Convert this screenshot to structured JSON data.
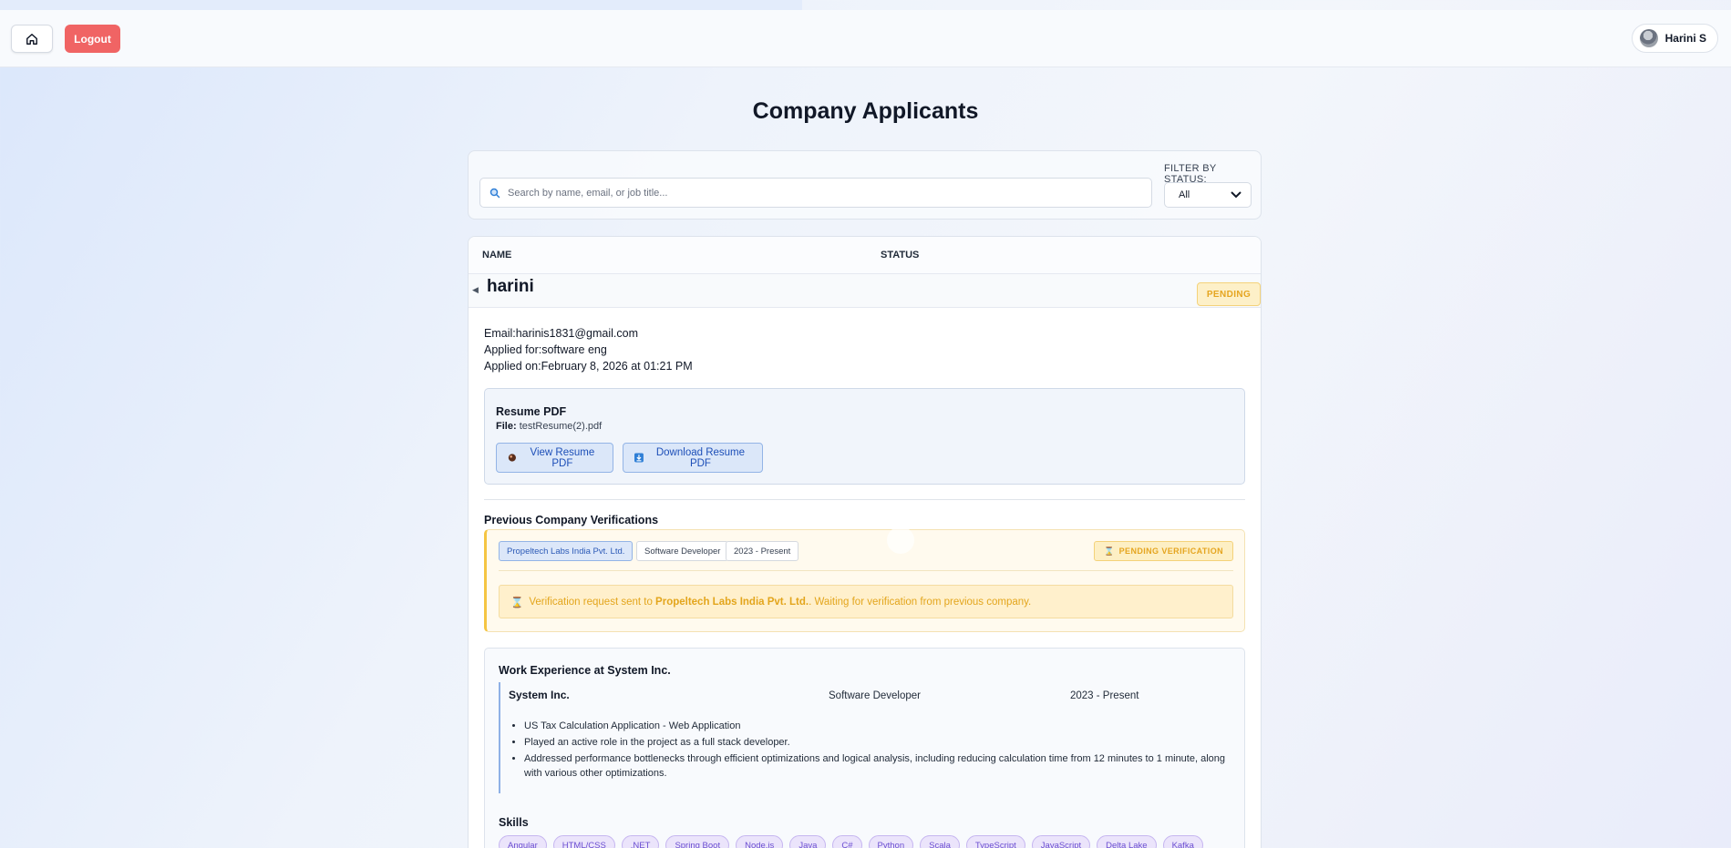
{
  "header": {
    "logout_label": "Logout",
    "user_name": "Harini S"
  },
  "page": {
    "title": "Company Applicants"
  },
  "filters": {
    "search_placeholder": "Search by name, email, or job title...",
    "status_label": "FILTER BY STATUS:",
    "status_value": "All"
  },
  "table": {
    "col_name": "NAME",
    "col_status": "STATUS"
  },
  "applicant": {
    "name": "harini",
    "status": "PENDING",
    "email_label": "Email:",
    "email": "harinis1831@gmail.com",
    "applied_for_label": "Applied for:",
    "applied_for": "software eng",
    "applied_on_label": "Applied on:",
    "applied_on": "February 8, 2026 at 01:21 PM",
    "resume": {
      "title": "Resume PDF",
      "file_label": "File:",
      "file_name": "testResume(2).pdf",
      "view_label": "View Resume PDF",
      "download_label": "Download Resume PDF"
    },
    "verifications": {
      "title": "Previous Company Verifications",
      "company": "Propeltech Labs India Pvt. Ltd.",
      "role": "Software Developer",
      "period": "2023 - Present",
      "badge": "PENDING VERIFICATION",
      "msg_prefix": "Verification request sent to ",
      "msg_company": "Propeltech Labs India Pvt. Ltd.",
      "msg_suffix": ". Waiting for verification from previous company."
    },
    "work": {
      "title": "Work Experience at System Inc.",
      "company": "System Inc.",
      "role": "Software Developer",
      "period": "2023 - Present",
      "bullets": [
        "US Tax Calculation Application - Web Application",
        "Played an active role in the project as a full stack developer.",
        "Addressed performance bottlenecks through efficient optimizations and logical analysis, including reducing calculation time from 12 minutes to 1 minute, along with various other optimizations."
      ]
    },
    "skills_title": "Skills",
    "skills": [
      "Angular",
      "HTML/CSS",
      ".NET",
      "Spring Boot",
      "Node.js",
      "Java",
      "C#",
      "Python",
      "Scala",
      "TypeScript",
      "JavaScript",
      "Delta Lake",
      "Kafka"
    ]
  },
  "colors": {
    "logout": "#f06464",
    "pending": "#e5a520",
    "link_blue": "#1d4fb8",
    "skill_purple": "#6b4ed1"
  },
  "icons": {
    "home": "home-icon",
    "search": "search-icon",
    "chevron": "chevron-down-icon",
    "view": "eye-icon",
    "download": "download-icon",
    "hourglass": "hourglass-icon",
    "caret": "caret-left-icon"
  }
}
